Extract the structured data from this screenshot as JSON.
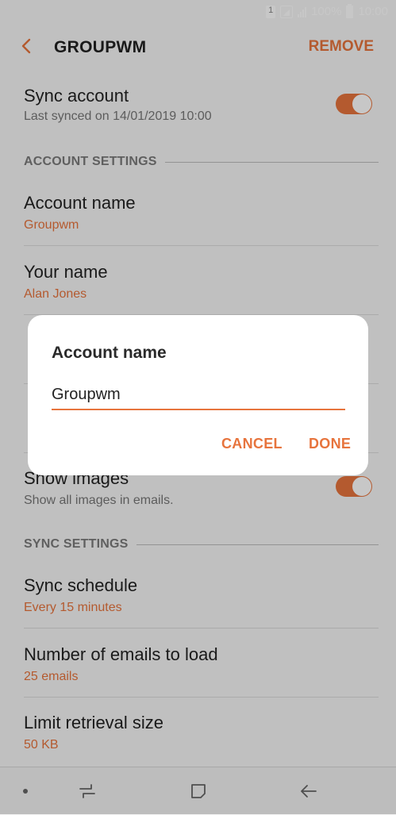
{
  "status_bar": {
    "battery": "100%",
    "time": "10:00"
  },
  "app_bar": {
    "title": "GROUPWM",
    "remove_label": "REMOVE"
  },
  "sync_account": {
    "title": "Sync account",
    "subtitle": "Last synced on 14/01/2019  10:00",
    "enabled": true
  },
  "sections": {
    "account_settings": "ACCOUNT SETTINGS",
    "sync_settings": "SYNC SETTINGS"
  },
  "account_items": [
    {
      "title": "Account name",
      "subtitle": "Groupwm"
    },
    {
      "title": "Your name",
      "subtitle": "Alan Jones"
    }
  ],
  "show_images": {
    "title": "Show images",
    "subtitle": "Show all images in emails.",
    "enabled": true
  },
  "sync_items": [
    {
      "title": "Sync schedule",
      "subtitle": "Every 15 minutes"
    },
    {
      "title": "Number of emails to load",
      "subtitle": "25 emails"
    },
    {
      "title": "Limit retrieval size",
      "subtitle": "50 KB"
    }
  ],
  "dialog": {
    "title": "Account name",
    "input_value": "Groupwm",
    "cancel_label": "CANCEL",
    "done_label": "DONE"
  },
  "colors": {
    "accent": "#e7743d",
    "background": "#f7f7f7"
  },
  "icons": {
    "back": "chevron-left-icon",
    "recents": "recents-icon",
    "home": "home-icon",
    "nav_back": "arrow-left-icon"
  }
}
